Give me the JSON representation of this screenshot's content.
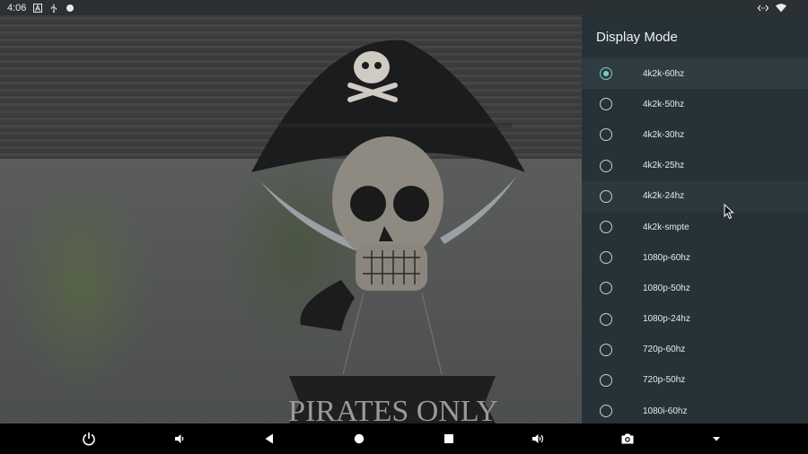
{
  "status_bar": {
    "time": "4:06",
    "left_icons": [
      "font-a-icon",
      "usb-icon",
      "circle-app-icon"
    ],
    "right_icons": [
      "ethernet-icon",
      "wifi-icon"
    ]
  },
  "wallpaper": {
    "description_icon": "pirate-skull-image",
    "sign_text": "PIRATES ONLY"
  },
  "panel": {
    "title": "Display Mode",
    "accent_color": "#80cbc4",
    "background_color": "#263238",
    "items": [
      {
        "label": "4k2k-60hz",
        "checked": true
      },
      {
        "label": "4k2k-50hz",
        "checked": false
      },
      {
        "label": "4k2k-30hz",
        "checked": false
      },
      {
        "label": "4k2k-25hz",
        "checked": false
      },
      {
        "label": "4k2k-24hz",
        "checked": false
      },
      {
        "label": "4k2k-smpte",
        "checked": false
      },
      {
        "label": "1080p-60hz",
        "checked": false
      },
      {
        "label": "1080p-50hz",
        "checked": false
      },
      {
        "label": "1080p-24hz",
        "checked": false
      },
      {
        "label": "720p-60hz",
        "checked": false
      },
      {
        "label": "720p-50hz",
        "checked": false
      },
      {
        "label": "1080i-60hz",
        "checked": false
      }
    ]
  },
  "nav_bar": {
    "buttons": [
      "power-icon",
      "volume-down-icon",
      "back-icon",
      "home-icon",
      "recents-icon",
      "volume-up-icon",
      "screenshot-icon",
      "dropdown-icon"
    ]
  }
}
